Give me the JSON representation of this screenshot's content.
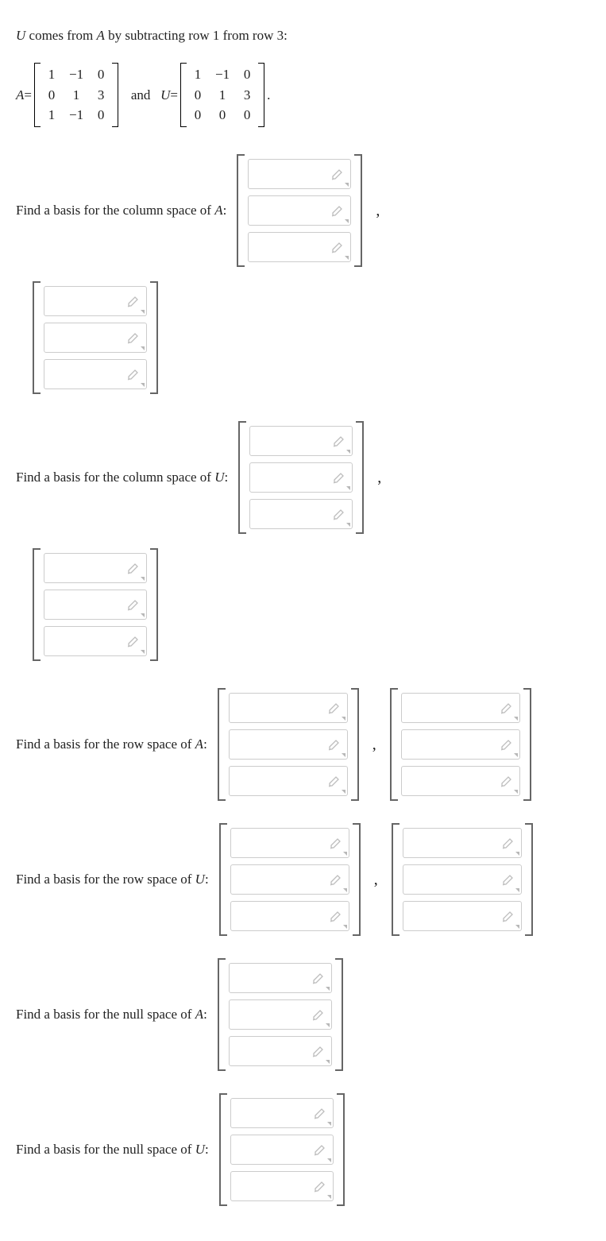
{
  "intro": {
    "pre": "U",
    "mid": " comes from ",
    "a": "A",
    "post": " by subtracting row 1 from row 3:"
  },
  "eq": {
    "A_label": "A",
    "eq1": " = ",
    "and": "and",
    "U_label": "U",
    "eq2": " = ",
    "period": ".",
    "matA": [
      "1",
      "0",
      "1",
      "−1",
      "1",
      "−1",
      "0",
      "3",
      "0"
    ],
    "matU": [
      "1",
      "0",
      "0",
      "−1",
      "1",
      "0",
      "0",
      "3",
      "0"
    ]
  },
  "questions": {
    "colA": "Find a basis for the column space of ",
    "colA_var": "A",
    "colon": ":",
    "colU": "Find a basis for the column space of ",
    "colU_var": "U",
    "rowA": "Find a basis for the row space of ",
    "rowA_var": "A",
    "rowU": "Find a basis for the row space of ",
    "rowU_var": "U",
    "nullA": "Find a basis for the null space of ",
    "nullA_var": "A",
    "nullU": "Find a basis for the null space of ",
    "nullU_var": "U"
  }
}
